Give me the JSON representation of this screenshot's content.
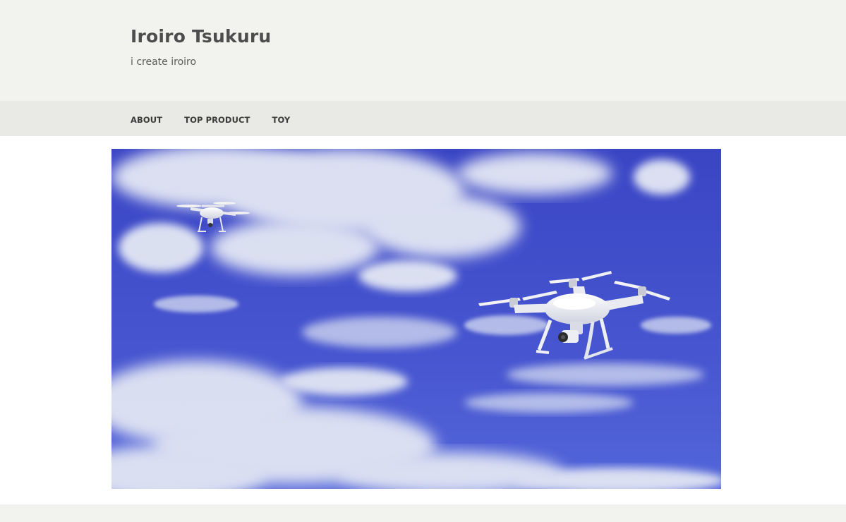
{
  "header": {
    "site_title": "Iroiro Tsukuru",
    "site_description": "i create iroiro"
  },
  "nav": {
    "items": [
      {
        "label": "ABOUT"
      },
      {
        "label": "TOP PRODUCT"
      },
      {
        "label": "TOY"
      }
    ]
  },
  "hero": {
    "subject": "two white quadcopter drones flying in a cloudy blue sky"
  },
  "colors": {
    "header_bg": "#f2f2ee",
    "nav_bg": "#e9e9e5",
    "sky_top": "#3a45c4",
    "sky_bottom": "#4f62d8"
  }
}
